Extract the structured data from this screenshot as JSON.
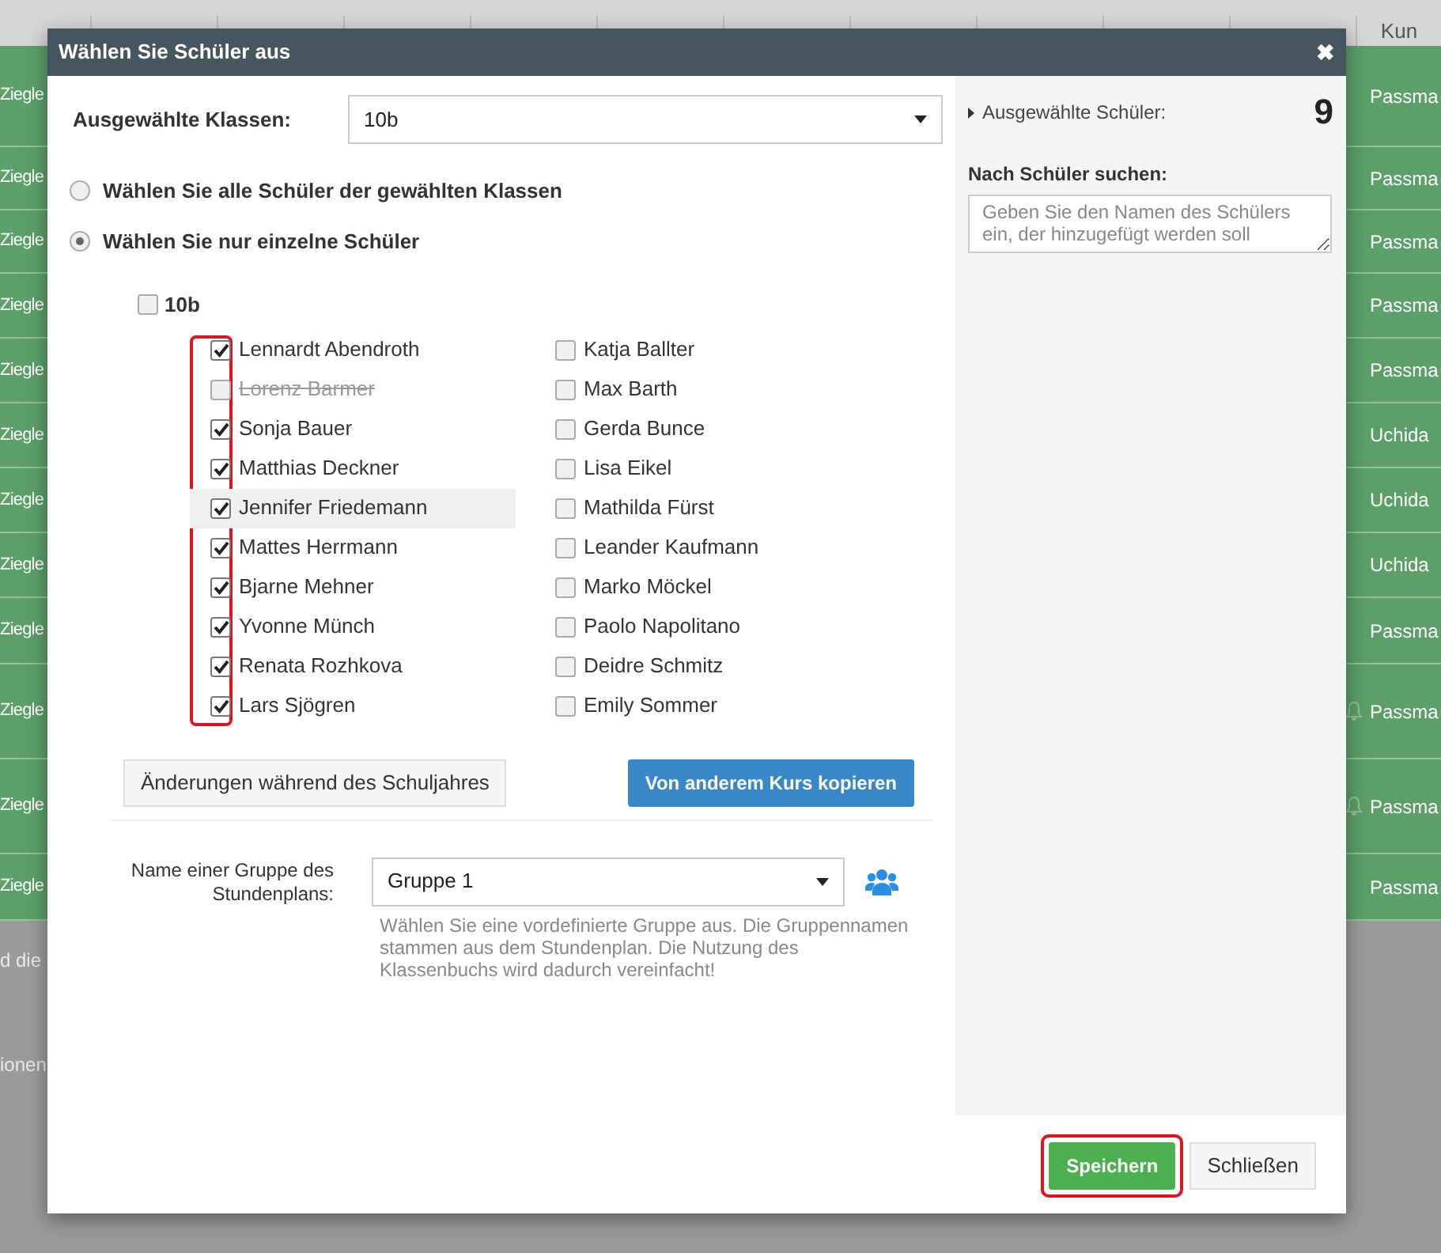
{
  "background_table": {
    "column_12": "Kun",
    "rows": [
      {
        "first": "Ziegle",
        "last": "Passma",
        "bell": false
      },
      {
        "first": "Ziegle",
        "last": "Passma",
        "bell": false
      },
      {
        "first": "Ziegle",
        "last": "Passma",
        "bell": false
      },
      {
        "first": "Ziegle",
        "last": "Passma",
        "bell": false
      },
      {
        "first": "Ziegle",
        "last": "Passma",
        "bell": false
      },
      {
        "first": "Ziegle",
        "last": "Uchida",
        "bell": false
      },
      {
        "first": "Ziegle",
        "last": "Uchida",
        "bell": false
      },
      {
        "first": "Ziegle",
        "last": "Uchida",
        "bell": false
      },
      {
        "first": "Ziegle",
        "last": "Passma",
        "bell": false
      },
      {
        "first": "Ziegle",
        "last": "Passma",
        "bell": true
      },
      {
        "first": "Ziegle",
        "last": "Passma",
        "bell": true
      },
      {
        "first": "Ziegle",
        "last": "Passma",
        "bell": false
      }
    ],
    "notes": [
      "d die",
      "ionen"
    ]
  },
  "dialog": {
    "title": "Wählen Sie Schüler aus",
    "close": "✖",
    "class_label": "Ausgewählte Klassen:",
    "class_value": "10b",
    "radios": [
      {
        "label": "Wählen Sie alle Schüler der gewählten Klassen",
        "selected": false
      },
      {
        "label": "Wählen Sie nur einzelne Schüler",
        "selected": true
      }
    ],
    "class_group": {
      "label": "10b",
      "checked": false
    },
    "checkbox_column_highlighted": true,
    "students": [
      {
        "name": "Lennardt Abendroth",
        "checked": true,
        "disabled": false,
        "hovered": false
      },
      {
        "name": "Lorenz Barmer",
        "checked": false,
        "disabled": true,
        "hovered": false
      },
      {
        "name": "Sonja Bauer",
        "checked": true,
        "disabled": false,
        "hovered": false
      },
      {
        "name": "Matthias Deckner",
        "checked": true,
        "disabled": false,
        "hovered": false
      },
      {
        "name": "Jennifer Friedemann",
        "checked": true,
        "disabled": false,
        "hovered": true
      },
      {
        "name": "Mattes Herrmann",
        "checked": true,
        "disabled": false,
        "hovered": false
      },
      {
        "name": "Bjarne Mehner",
        "checked": true,
        "disabled": false,
        "hovered": false
      },
      {
        "name": "Yvonne Münch",
        "checked": true,
        "disabled": false,
        "hovered": false
      },
      {
        "name": "Renata Rozhkova",
        "checked": true,
        "disabled": false,
        "hovered": false
      },
      {
        "name": "Lars Sjögren",
        "checked": true,
        "disabled": false,
        "hovered": false
      },
      {
        "name": "Katja Ballter",
        "checked": false,
        "disabled": false,
        "hovered": false
      },
      {
        "name": "Max Barth",
        "checked": false,
        "disabled": false,
        "hovered": false
      },
      {
        "name": "Gerda Bunce",
        "checked": false,
        "disabled": false,
        "hovered": false
      },
      {
        "name": "Lisa Eikel",
        "checked": false,
        "disabled": false,
        "hovered": false
      },
      {
        "name": "Mathilda Fürst",
        "checked": false,
        "disabled": false,
        "hovered": false
      },
      {
        "name": "Leander Kaufmann",
        "checked": false,
        "disabled": false,
        "hovered": false
      },
      {
        "name": "Marko Möckel",
        "checked": false,
        "disabled": false,
        "hovered": false
      },
      {
        "name": "Paolo Napolitano",
        "checked": false,
        "disabled": false,
        "hovered": false
      },
      {
        "name": "Deidre Schmitz",
        "checked": false,
        "disabled": false,
        "hovered": false
      },
      {
        "name": "Emily Sommer",
        "checked": false,
        "disabled": false,
        "hovered": false
      }
    ],
    "changes_button": "Änderungen während des Schuljahres",
    "copy_button": "Von anderem Kurs kopieren",
    "group_label": "Name einer Gruppe des Stundenplans:",
    "group_value": "Gruppe 1",
    "group_help": "Wählen Sie eine vordefinierte Gruppe aus. Die Gruppennamen stammen aus dem Stundenplan. Die Nutzung des Klassenbuchs wird dadurch vereinfacht!",
    "selected_label": "Ausgewählte Schüler:",
    "selected_count": "9",
    "search_label": "Nach Schüler suchen:",
    "search_placeholder": "Geben Sie den Namen des Schülers ein, der hinzugefügt werden soll",
    "save_button": {
      "label": "Speichern",
      "highlighted": true
    },
    "close_button": "Schließen"
  }
}
